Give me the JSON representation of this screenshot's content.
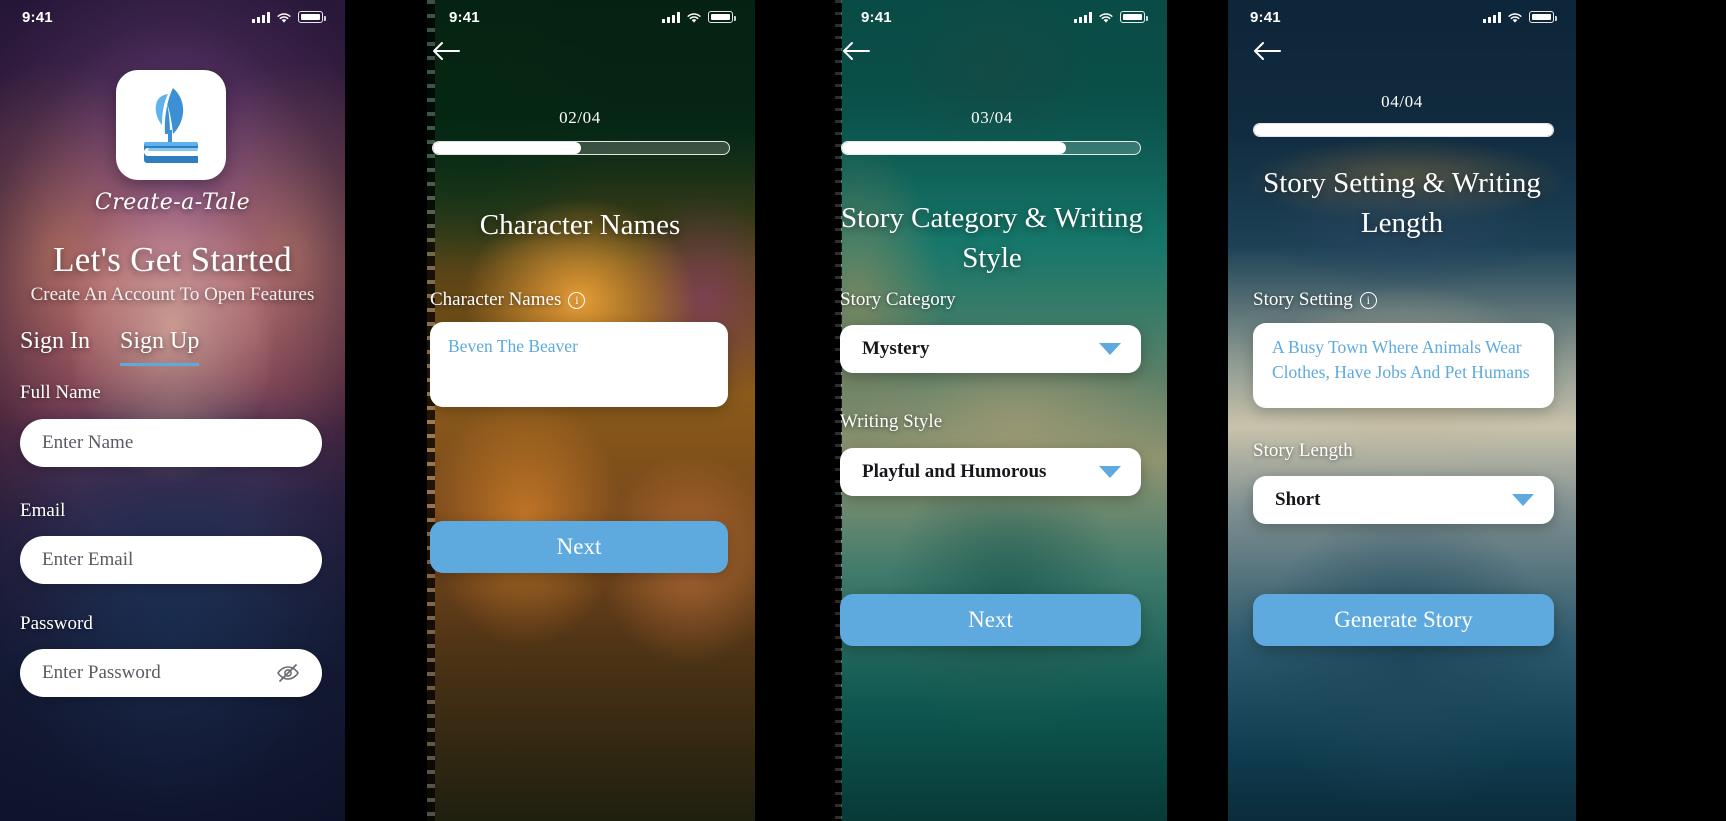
{
  "status_bar": {
    "time": "9:41",
    "signal_icon": "cellular-bars-icon",
    "wifi_icon": "wifi-icon",
    "battery_icon": "battery-icon"
  },
  "theme": {
    "accent": "#5ea9de",
    "card": "#ffffff",
    "text_on_image": "#ffffff",
    "placeholder": "#5a5a62"
  },
  "screens": [
    {
      "id": "signup",
      "brand": "Create-a-Tale",
      "logo_icon": "quill-and-book-icon",
      "headline": "Let's Get Started",
      "subhead": "Create An Account To Open Features",
      "tabs": [
        {
          "label": "Sign In",
          "active": false
        },
        {
          "label": "Sign Up",
          "active": true
        }
      ],
      "fields": [
        {
          "label": "Full Name",
          "placeholder": "Enter Name"
        },
        {
          "label": "Email",
          "placeholder": "Enter Email"
        },
        {
          "label": "Password",
          "placeholder": "Enter Password",
          "trailing_icon": "eye-off-icon"
        }
      ]
    },
    {
      "id": "character-names",
      "back_icon": "arrow-left-icon",
      "step": "02/04",
      "progress_percent": 50,
      "title": "Character Names",
      "field_label": "Character Names",
      "info_icon": "info-circle-icon",
      "value": "Beven The Beaver",
      "cta": "Next"
    },
    {
      "id": "category-style",
      "back_icon": "arrow-left-icon",
      "step": "03/04",
      "progress_percent": 75,
      "title": "Story Category & Writing Style",
      "dropdowns": [
        {
          "label": "Story Category",
          "value": "Mystery",
          "caret_icon": "chevron-down-icon"
        },
        {
          "label": "Writing Style",
          "value": "Playful and Humorous",
          "caret_icon": "chevron-down-icon"
        }
      ],
      "cta": "Next"
    },
    {
      "id": "setting-length",
      "back_icon": "arrow-left-icon",
      "step": "04/04",
      "progress_percent": 100,
      "title": "Story Setting & Writing Length",
      "field_label": "Story Setting",
      "info_icon": "info-circle-icon",
      "value": "A Busy Town Where Animals Wear Clothes, Have Jobs And Pet Humans",
      "length_label": "Story Length",
      "length_value": "Short",
      "caret_icon": "chevron-down-icon",
      "cta": "Generate Story"
    }
  ]
}
